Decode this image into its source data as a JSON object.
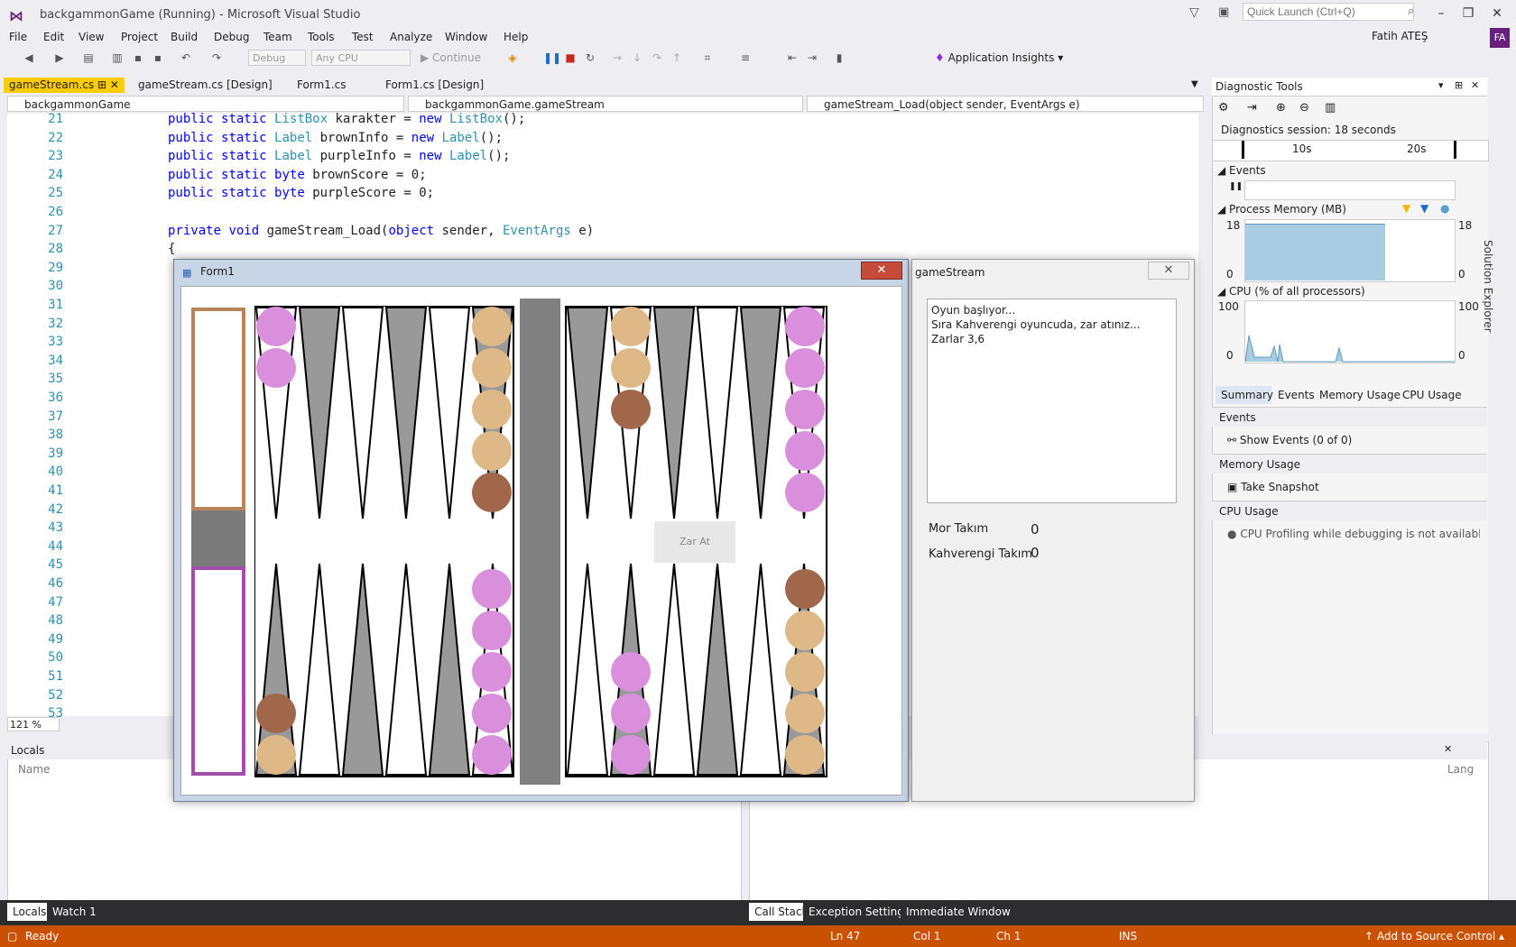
{
  "window": {
    "title": "backgammonGame (Running) - Microsoft Visual Studio",
    "quick_launch_placeholder": "Quick Launch (Ctrl+Q)"
  },
  "menu": [
    "File",
    "Edit",
    "View",
    "Project",
    "Build",
    "Debug",
    "Team",
    "Tools",
    "Test",
    "Analyze",
    "Window",
    "Help"
  ],
  "user": {
    "name": "Fatih ATEŞ",
    "initials": "FA"
  },
  "toolbar": {
    "config": "Debug",
    "platform": "Any CPU",
    "continue_label": "Continue",
    "insights_label": "Application Insights"
  },
  "tabs": [
    {
      "label": "gameStream.cs",
      "active": true
    },
    {
      "label": "gameStream.cs [Design]",
      "active": false
    },
    {
      "label": "Form1.cs",
      "active": false
    },
    {
      "label": "Form1.cs [Design]",
      "active": false
    }
  ],
  "nav": {
    "project": "backgammonGame",
    "class": "backgammonGame.gameStream",
    "member": "gameStream_Load(object sender, EventArgs e)"
  },
  "code_lines": [
    {
      "n": "21",
      "text": "public static ListBox karakter = new ListBox();"
    },
    {
      "n": "22",
      "text": "public static Label brownInfo = new Label();"
    },
    {
      "n": "23",
      "text": "public static Label purpleInfo = new Label();"
    },
    {
      "n": "24",
      "text": "public static byte brownScore = 0;"
    },
    {
      "n": "25",
      "text": "public static byte purpleScore = 0;"
    },
    {
      "n": "26",
      "text": ""
    },
    {
      "n": "27",
      "text": "private void gameStream_Load(object sender, EventArgs e)"
    },
    {
      "n": "28",
      "text": "{"
    },
    {
      "n": "29",
      "text": ""
    },
    {
      "n": "30",
      "text": ""
    },
    {
      "n": "31",
      "text": ""
    },
    {
      "n": "32",
      "text": ""
    },
    {
      "n": "33",
      "text": ""
    },
    {
      "n": "34",
      "text": ""
    },
    {
      "n": "35",
      "text": ""
    },
    {
      "n": "36",
      "text": ""
    },
    {
      "n": "37",
      "text": ""
    },
    {
      "n": "38",
      "text": ""
    },
    {
      "n": "39",
      "text": ""
    },
    {
      "n": "40",
      "text": ""
    },
    {
      "n": "41",
      "text": ""
    },
    {
      "n": "42",
      "text": ""
    },
    {
      "n": "43",
      "text": ""
    },
    {
      "n": "44",
      "text": ""
    },
    {
      "n": "45",
      "text": ""
    },
    {
      "n": "46",
      "text": ""
    },
    {
      "n": "47",
      "text": ""
    },
    {
      "n": "48",
      "text": ""
    },
    {
      "n": "49",
      "text": ""
    },
    {
      "n": "50",
      "text": ""
    },
    {
      "n": "51",
      "text": ""
    },
    {
      "n": "52",
      "text": ""
    },
    {
      "n": "53",
      "text": ""
    }
  ],
  "zoom": "121 %",
  "diagnostics": {
    "title": "Diagnostic Tools",
    "session": "Diagnostics session: 18 seconds",
    "timeline_ticks": [
      "10s",
      "20s"
    ],
    "events_label": "Events",
    "memory_label": "Process Memory (MB)",
    "memory_max": "18",
    "memory_min": "0",
    "cpu_label": "CPU (% of all processors)",
    "cpu_max": "100",
    "cpu_min": "0",
    "subtabs": [
      "Summary",
      "Events",
      "Memory Usage",
      "CPU Usage"
    ],
    "sec_events": "Events",
    "show_events": "Show Events (0 of 0)",
    "sec_memory": "Memory Usage",
    "take_snapshot": "Take Snapshot",
    "sec_cpu": "CPU Usage",
    "cpu_note": "CPU Profiling while debugging is not available o"
  },
  "side_tab": "Solution Explorer",
  "locals": {
    "title": "Locals",
    "col_name": "Name",
    "col_lang": "Lang"
  },
  "bottom_tabs_left": [
    "Locals",
    "Watch 1"
  ],
  "bottom_tabs_right": [
    "Call Stack",
    "Exception Settings",
    "Immediate Window"
  ],
  "status": {
    "ready": "Ready",
    "ln": "Ln 47",
    "col": "Col 1",
    "ch": "Ch 1",
    "ins": "INS",
    "source_control": "Add to Source Control"
  },
  "form1": {
    "title": "Form1",
    "dice_button": "Zar At"
  },
  "gamestream": {
    "title": "gameStream",
    "log": [
      "Oyun başlıyor...",
      "Sıra Kahverengi oyuncuda, zar atınız...",
      "Zarlar 3,6"
    ],
    "purple_label": "Mor Takım",
    "purple_score": "0",
    "brown_label": "Kahverengi Takım",
    "brown_score": "0"
  }
}
